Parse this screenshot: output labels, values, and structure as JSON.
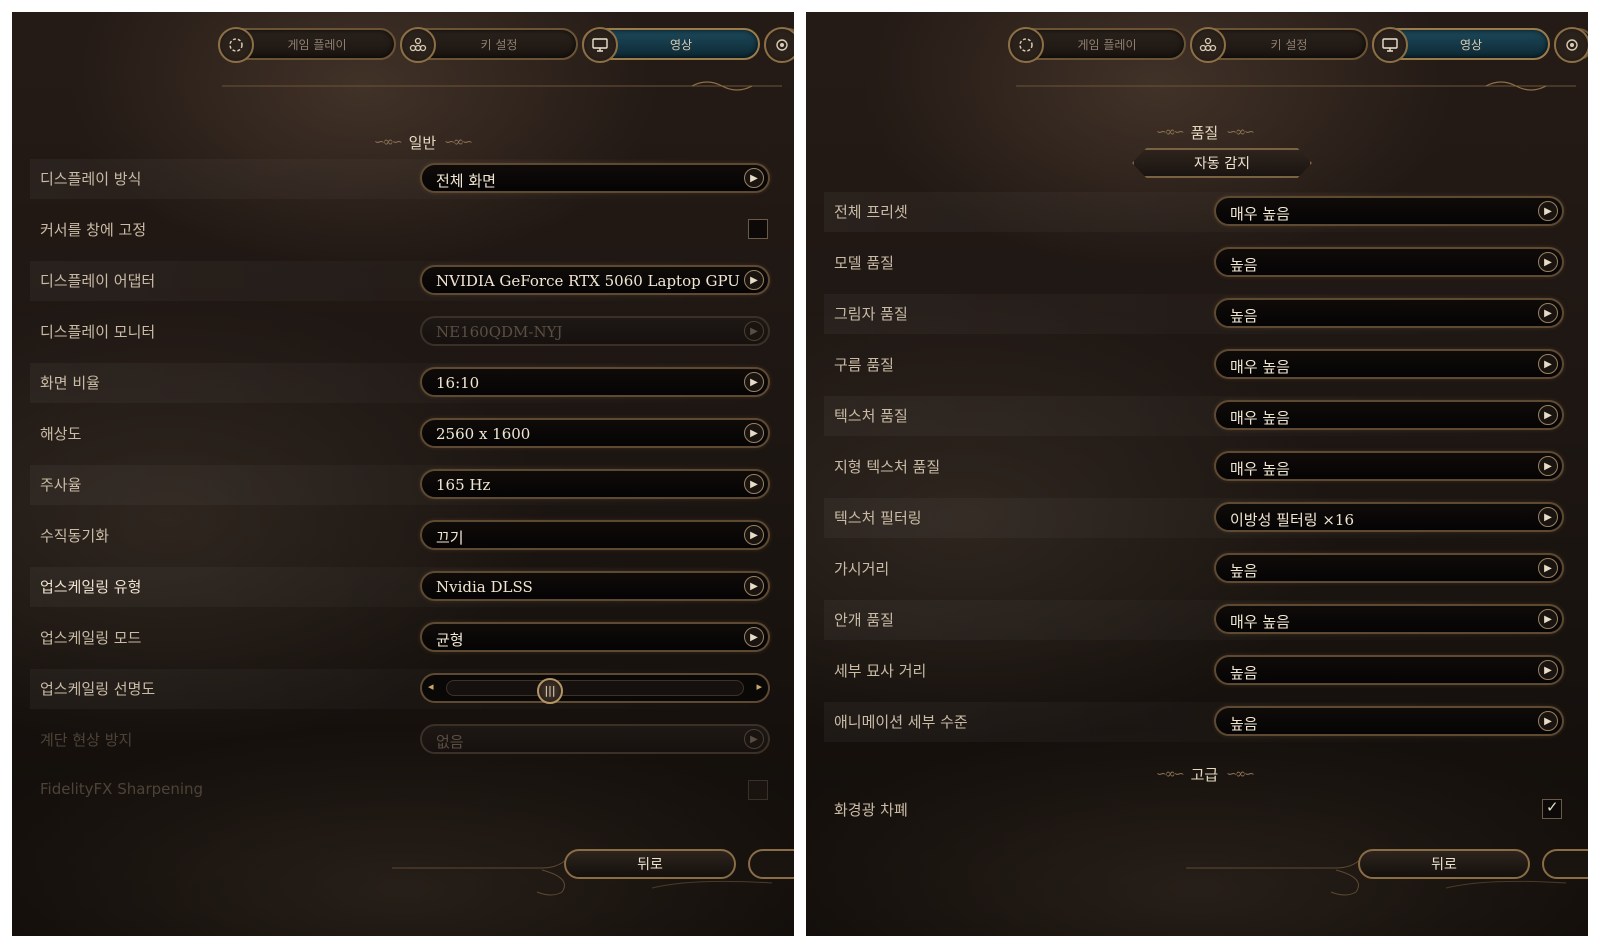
{
  "tabs": [
    {
      "label": "게임 플레이",
      "icon": "gameplay-icon"
    },
    {
      "label": "키 설정",
      "icon": "keybind-icon"
    },
    {
      "label": "영상",
      "icon": "monitor-icon"
    },
    {
      "label": "",
      "icon": "audio-icon"
    }
  ],
  "left": {
    "section_title": "일반",
    "rows": [
      {
        "label": "디스플레이 방식",
        "value": "전체 화면"
      },
      {
        "label": "커서를 창에 고정"
      },
      {
        "label": "디스플레이 어댑터",
        "value": "NVIDIA GeForce RTX 5060 Laptop GPU"
      },
      {
        "label": "디스플레이 모니터",
        "value": "NE160QDM-NYJ"
      },
      {
        "label": "화면 비율",
        "value": "16:10"
      },
      {
        "label": "해상도",
        "value": "2560 x 1600"
      },
      {
        "label": "주사율",
        "value": "165 Hz"
      },
      {
        "label": "수직동기화",
        "value": "끄기"
      },
      {
        "label": "업스케일링 유형",
        "value": "Nvidia DLSS"
      },
      {
        "label": "업스케일링 모드",
        "value": "균형"
      },
      {
        "label": "업스케일링 선명도"
      },
      {
        "label": "계단 현상 방지",
        "value": "없음"
      },
      {
        "label": "FidelityFX Sharpening"
      }
    ],
    "back_label": "뒤로"
  },
  "right": {
    "section_title": "품질",
    "auto_detect_label": "자동 감지",
    "rows": [
      {
        "label": "전체 프리셋",
        "value": "매우 높음"
      },
      {
        "label": "모델 품질",
        "value": "높음"
      },
      {
        "label": "그림자 품질",
        "value": "높음"
      },
      {
        "label": "구름 품질",
        "value": "매우 높음"
      },
      {
        "label": "텍스처 품질",
        "value": "매우 높음"
      },
      {
        "label": "지형 텍스처 품질",
        "value": "매우 높음"
      },
      {
        "label": "텍스처 필터링",
        "value": "이방성 필터링 ×16"
      },
      {
        "label": "가시거리",
        "value": "높음"
      },
      {
        "label": "안개 품질",
        "value": "매우 높음"
      },
      {
        "label": "세부 묘사 거리",
        "value": "높음"
      },
      {
        "label": "애니메이션 세부 수준",
        "value": "높음"
      }
    ],
    "advanced_title": "고급",
    "advanced_row": {
      "label": "화경광 차폐"
    },
    "back_label": "뒤로"
  },
  "slider_level": 0.33,
  "checkbox_cursor_lock": false,
  "checkbox_sharpening": false,
  "checkbox_ambient_occlusion": true
}
